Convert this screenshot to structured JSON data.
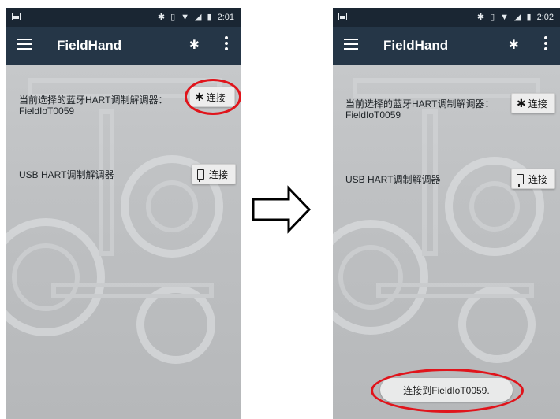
{
  "screens": [
    {
      "status_time": "2:01",
      "app_title": "FieldHand",
      "bluetooth_modem_label": "当前选择的蓝牙HART调制解调器：",
      "bluetooth_modem_device": "FieldIoT0059",
      "bluetooth_connect_label": "连接",
      "usb_modem_label": "USB HART调制解调器",
      "usb_connect_label": "连接"
    },
    {
      "status_time": "2:02",
      "app_title": "FieldHand",
      "bluetooth_modem_label": "当前选择的蓝牙HART调制解调器：",
      "bluetooth_modem_device": "FieldIoT0059",
      "bluetooth_connect_label": "连接",
      "usb_modem_label": "USB HART调制解调器",
      "usb_connect_label": "连接",
      "toast_message": "连接到FieldIoT0059."
    }
  ],
  "icons": {
    "status_left": "image-icon",
    "bluetooth": "bluetooth-icon",
    "vibrate": "vibrate-icon",
    "wifi": "wifi-icon",
    "signal": "signal-icon",
    "battery": "battery-icon",
    "menu": "hamburger-menu-icon",
    "overflow": "overflow-menu-icon",
    "usb": "usb-icon",
    "transition_arrow": "right-arrow-icon"
  },
  "colors": {
    "status_bar": "#1a2633",
    "app_bar": "#253647",
    "highlight": "#e0141b",
    "screen_background": "#c4c6c8"
  }
}
